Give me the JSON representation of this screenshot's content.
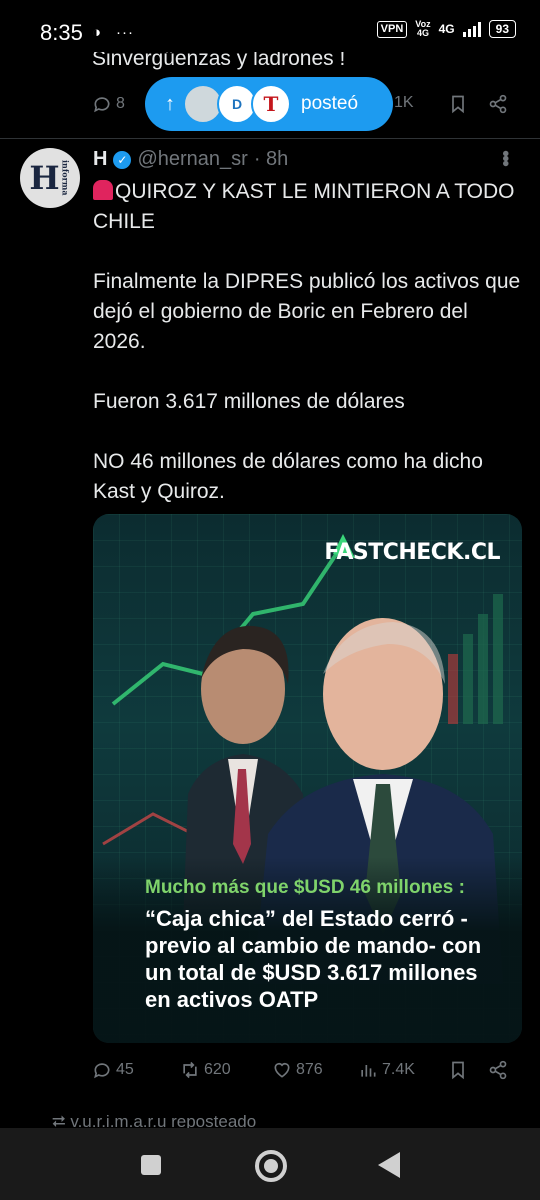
{
  "status_bar": {
    "time": "8:35",
    "vpn": "VPN",
    "net_1": "Voz",
    "net_2": "4G",
    "net_3": "4G",
    "battery": "93"
  },
  "previous_post": {
    "text": "Sinvergüenzas y ladrones !",
    "replies": "8",
    "views": "1K"
  },
  "new_posts_pill": {
    "label": "posteó"
  },
  "post": {
    "name": "H",
    "handle": "@hernan_sr",
    "time": "· 8h",
    "avatar_text": "H",
    "avatar_small": "informa",
    "text_1": "QUIROZ Y KAST LE MINTIERON A TODO CHILE",
    "text_2": "Finalmente la DIPRES publicó los activos que dejó el gobierno de Boric en Febrero del 2026.",
    "text_3": "Fueron 3.617 millones de dólares",
    "text_4": "NO 46 millones de dólares como ha dicho Kast y Quiroz.",
    "media": {
      "brand": "FASTCHECK.CL",
      "caption_1": "Mucho más que $USD 46 millones :",
      "caption_2": "“Caja chica” del Estado cerró -previo al cambio de mando- con un total de $USD 3.617 millones en activos OATP"
    },
    "replies": "45",
    "reposts": "620",
    "likes": "876",
    "views": "7.4K"
  },
  "next_post": {
    "reposted_by": "v.u.r.i.m.a.r.u reposteado"
  },
  "colors": {
    "accent": "#1d9bf0",
    "muted": "#71767b",
    "text": "#e7e9ea"
  }
}
